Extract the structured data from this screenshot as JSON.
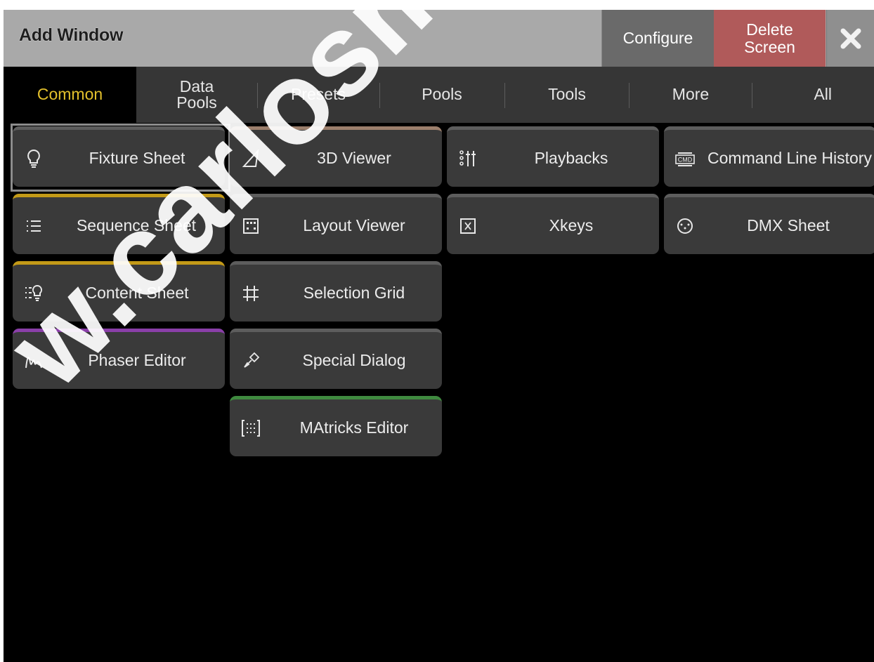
{
  "window": {
    "title": "Add Window"
  },
  "titlebar": {
    "configure_label": "Configure",
    "delete_label": "Delete Screen",
    "close_icon": "close-icon"
  },
  "tabs": [
    {
      "label": "Common",
      "active": true
    },
    {
      "label": "Data Pools",
      "active": false
    },
    {
      "label": "Presets",
      "active": false
    },
    {
      "label": "Pools",
      "active": false
    },
    {
      "label": "Tools",
      "active": false
    },
    {
      "label": "More",
      "active": false
    },
    {
      "label": "All",
      "active": false
    }
  ],
  "buttons": [
    {
      "label": "Fixture Sheet",
      "icon": "bulb-icon",
      "accent": "#5d5d5d",
      "selected": true
    },
    {
      "label": "Sequence Sheet",
      "icon": "list-icon",
      "accent": "#c39a17"
    },
    {
      "label": "Content Sheet",
      "icon": "content-sheet-icon",
      "accent": "#c39a17"
    },
    {
      "label": "Phaser Editor",
      "icon": "phaser-wave-icon",
      "accent": "#8a3fa8"
    },
    {
      "label": "3D Viewer",
      "icon": "3d-viewer-icon",
      "accent": "#9c7f6c"
    },
    {
      "label": "Layout Viewer",
      "icon": "layout-grid-icon",
      "accent": "#5d5d5d"
    },
    {
      "label": "Selection Grid",
      "icon": "selection-grid-icon",
      "accent": "#5d5d5d"
    },
    {
      "label": "Special Dialog",
      "icon": "special-dialog-icon",
      "accent": "#5d5d5d"
    },
    {
      "label": "MAtricks Editor",
      "icon": "matricks-icon",
      "accent": "#3f8a3f"
    },
    {
      "label": "Playbacks",
      "icon": "faders-icon",
      "accent": "#5d5d5d"
    },
    {
      "label": "Xkeys",
      "icon": "xkeys-icon",
      "accent": "#5d5d5d"
    },
    {
      "label": "Command Line History",
      "icon": "cmd-icon",
      "accent": "#5d5d5d"
    },
    {
      "label": "DMX Sheet",
      "icon": "dmx-connector-icon",
      "accent": "#5d5d5d"
    }
  ],
  "watermark": "w.carlosmendoza.c"
}
